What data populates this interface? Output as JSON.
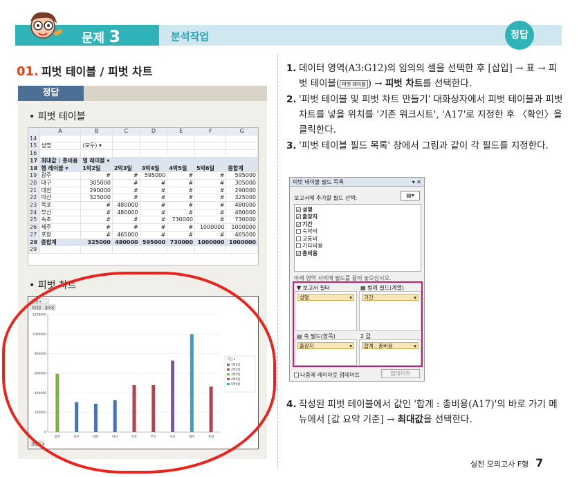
{
  "header": {
    "problem_label": "문제",
    "problem_num": "3",
    "subject": "분석작업",
    "badge": "정답"
  },
  "question": {
    "num": "01.",
    "title": "피벗 테이블 / 피벗 차트"
  },
  "answer_label": "정답",
  "section_table": "• 피벗 테이블",
  "section_chart": "• 피벗 차트",
  "sheet": {
    "cols": [
      "",
      "A",
      "B",
      "C",
      "D",
      "E",
      "F",
      "G"
    ],
    "rows": [
      [
        "14",
        "",
        "",
        "",
        "",
        "",
        "",
        ""
      ],
      [
        "15",
        "성명",
        "(모두)",
        "",
        "",
        "",
        "",
        ""
      ],
      [
        "16",
        "",
        "",
        "",
        "",
        "",
        "",
        ""
      ],
      [
        "17",
        "최대값 : 총비용",
        "열 레이블",
        "",
        "",
        "",
        "",
        ""
      ],
      [
        "18",
        "행 레이블",
        "1박2일",
        "2박3일",
        "3박4일",
        "4박5일",
        "5박6일",
        "총합계"
      ],
      [
        "19",
        "광주",
        "#",
        "#",
        "595000",
        "#",
        "#",
        "595000"
      ],
      [
        "20",
        "대구",
        "305000",
        "#",
        "#",
        "#",
        "#",
        "305000"
      ],
      [
        "21",
        "대전",
        "290000",
        "#",
        "#",
        "#",
        "#",
        "290000"
      ],
      [
        "22",
        "마산",
        "325000",
        "#",
        "#",
        "#",
        "#",
        "325000"
      ],
      [
        "23",
        "목포",
        "#",
        "480000",
        "#",
        "#",
        "#",
        "480000"
      ],
      [
        "24",
        "부산",
        "#",
        "480000",
        "#",
        "#",
        "#",
        "480000"
      ],
      [
        "25",
        "속초",
        "#",
        "#",
        "#",
        "730000",
        "#",
        "730000"
      ],
      [
        "26",
        "제주",
        "#",
        "#",
        "#",
        "#",
        "1000000",
        "1000000"
      ],
      [
        "27",
        "포항",
        "#",
        "465000",
        "#",
        "#",
        "#",
        "465000"
      ],
      [
        "28",
        "총합계",
        "325000",
        "480000",
        "595000",
        "730000",
        "1000000",
        "1000000"
      ],
      [
        "29",
        "",
        "",
        "",
        "",
        "",
        "",
        ""
      ]
    ]
  },
  "chart_data": {
    "type": "bar",
    "categories": [
      "광주",
      "대구",
      "대전",
      "마산",
      "목포",
      "부산",
      "속초",
      "제주",
      "포항"
    ],
    "series": [
      {
        "name": "1박2일",
        "values": [
          0,
          305000,
          290000,
          325000,
          0,
          0,
          0,
          0,
          0
        ]
      },
      {
        "name": "2박3일",
        "values": [
          0,
          0,
          0,
          0,
          480000,
          480000,
          0,
          0,
          465000
        ]
      },
      {
        "name": "3박4일",
        "values": [
          595000,
          0,
          0,
          0,
          0,
          0,
          0,
          0,
          0
        ]
      },
      {
        "name": "4박5일",
        "values": [
          0,
          0,
          0,
          0,
          0,
          0,
          730000,
          0,
          0
        ]
      },
      {
        "name": "5박6일",
        "values": [
          0,
          0,
          0,
          0,
          0,
          0,
          0,
          1000000,
          0
        ]
      }
    ],
    "yticks": [
      "0",
      "200000",
      "400000",
      "600000",
      "800000",
      "1000000",
      "1200000"
    ],
    "ylim": [
      0,
      1200000
    ],
    "filter_field": "성명",
    "value_label": "최대값 : 총비용",
    "legend_title": "기간",
    "axis_field": "출장지",
    "colors": [
      "#4a72b8",
      "#b8404a",
      "#7db04a",
      "#7a58a8",
      "#3aa0c0"
    ]
  },
  "steps": [
    {
      "n": "1.",
      "a": "데이터 영역(A3:G12)의 임의의 셀을 선택한 후 [삽입] → 표 → 피벗 테이블(",
      "btn": "피벗 테이블",
      "b": ") → ",
      "bold": "피벗 차트",
      "c": "를 선택한다."
    },
    {
      "n": "2.",
      "text": "'피벗 테이블 및 피벗 차트 만들기' 대화상자에서 피벗 테이블과 피벗 차트를 넣을 위치를 '기존 워크시트', 'A17'로 지정한 후 〈확인〉을 클릭한다."
    },
    {
      "n": "3.",
      "text": "'피벗 테이블 필드 목록' 창에서 그림과 같이 각 필드를 지정한다."
    },
    {
      "n": "4.",
      "a": "작성된 피벗 테이블에서 값인 '합계 : 총비용(A17)'의 바로 가기 메뉴에서 [값 요약 기준] → ",
      "bold": "최대값",
      "c": "을 선택한다."
    }
  ],
  "dialog": {
    "title": "피벗 테이블 필드 목록",
    "choose_label": "보고서에 추가할 필드 선택:",
    "fields": [
      {
        "label": "성명",
        "checked": "✓"
      },
      {
        "label": "출장지",
        "checked": "✓"
      },
      {
        "label": "기간",
        "checked": "✓"
      },
      {
        "label": "숙박비",
        "checked": ""
      },
      {
        "label": "교통비",
        "checked": ""
      },
      {
        "label": "기타비용",
        "checked": ""
      },
      {
        "label": "총비용",
        "checked": "✓"
      }
    ],
    "drag_label": "아래 영역 사이에 필드를 끌어 놓으십시오.",
    "zone_filter": "보고서 필터",
    "zone_legend": "범례 필드(계열)",
    "zone_axis": "축 필드(항목)",
    "zone_values": "값",
    "pill_filter": "성명",
    "pill_legend": "기간",
    "pill_axis": "출장지",
    "pill_values": "합계 : 총비용",
    "defer_label": "나중에 레이아웃 업데이트",
    "update_btn": "업데이트"
  },
  "footer": {
    "text": "실전 모의고사 F형",
    "page": "7"
  }
}
